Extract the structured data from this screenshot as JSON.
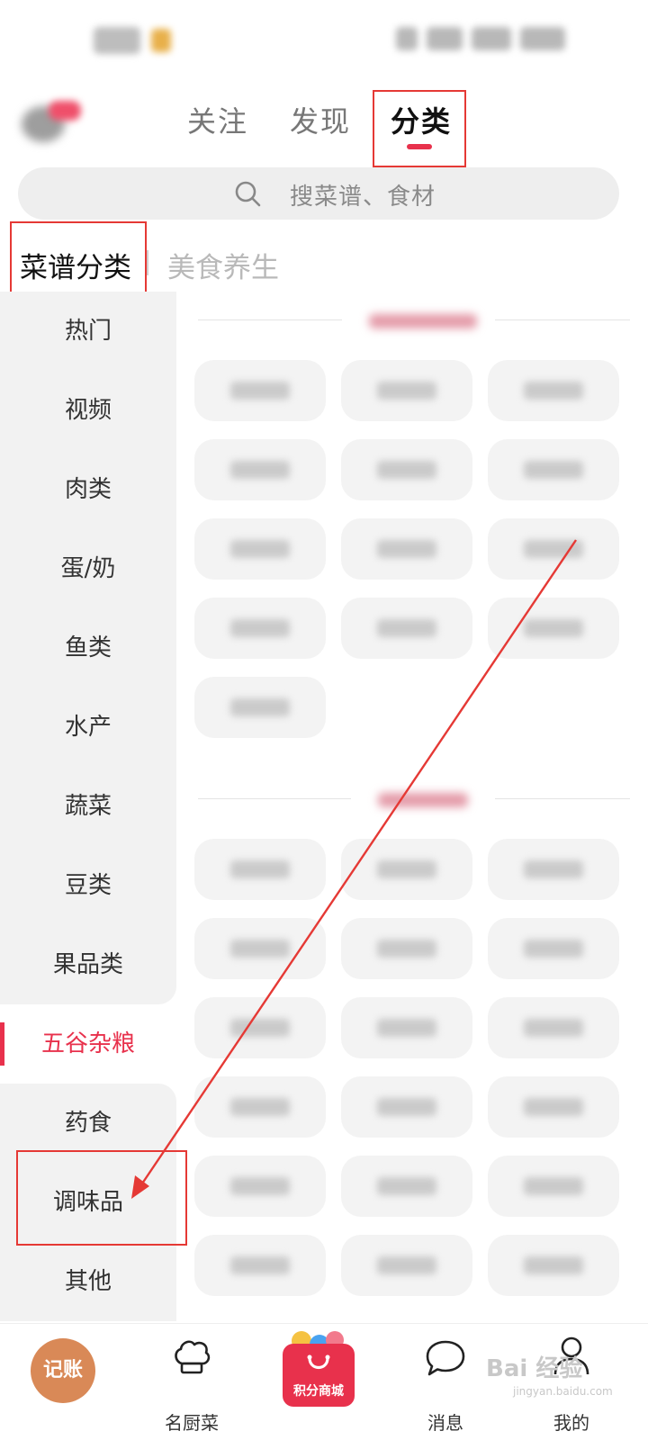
{
  "top_tabs": [
    "关注",
    "发现",
    "分类"
  ],
  "search": {
    "placeholder": "搜菜谱、食材"
  },
  "sub_tabs": [
    "菜谱分类",
    "美食养生"
  ],
  "sidebar": {
    "items": [
      "热门",
      "视频",
      "肉类",
      "蛋/奶",
      "鱼类",
      "水产",
      "蔬菜",
      "豆类",
      "果品类",
      "五谷杂粮",
      "药食",
      "调味品",
      "其他"
    ],
    "active_index": 9
  },
  "bottom_nav": {
    "jizhang": "记账",
    "chef": "名厨菜",
    "mall": "积分商城",
    "messages": "消息",
    "mine": "我的"
  },
  "watermark": {
    "brand": "Bai 经验",
    "url": "jingyan.baidu.com"
  },
  "colors": {
    "accent": "#e8314c",
    "annotation": "#e53935",
    "jizhang_bg": "#d98957"
  }
}
